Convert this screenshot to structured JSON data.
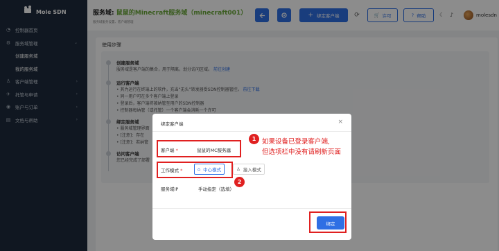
{
  "sidebar": {
    "logo": "Mole SDN",
    "items": [
      {
        "icon": "dashboard-icon",
        "label": "控制器首页",
        "chevron": false
      },
      {
        "icon": "gear-icon",
        "label": "服务域管理",
        "chevron": true
      },
      {
        "sub": true,
        "label": "创建服务域"
      },
      {
        "sub": true,
        "label": "我的服务域"
      },
      {
        "icon": "user-icon",
        "label": "客户端管理",
        "chevron": true
      },
      {
        "icon": "plane-icon",
        "label": "托管与申请",
        "chevron": true
      },
      {
        "icon": "account-icon",
        "label": "账户与订单",
        "chevron": true
      },
      {
        "icon": "doc-icon",
        "label": "文档与帮助",
        "chevron": true
      }
    ]
  },
  "header": {
    "title_prefix": "服务域:",
    "title_highlight": "鼠鼠的Minecraft服务域",
    "title_suffix": "（minecraft001）",
    "subtitle": "服务域服务设置、客户端管理",
    "bind_client_label": "绑定客户端",
    "license_label": "许可",
    "help_label": "帮助",
    "username": "molesdn"
  },
  "steps": {
    "card_title": "使用步骤",
    "items": [
      {
        "heading": "创建服务域",
        "lines": [
          {
            "text": "服务域是客户端的集合，用于隔离，划分访问区域。",
            "link": "前往创建"
          }
        ]
      },
      {
        "heading": "运行客户端",
        "lines": [
          {
            "text": "其为运行在终端上的软件，充当“无头”转发器受SDN控制器管控。",
            "link": "前往下载"
          },
          {
            "text": "同一用户可在多个客户端上登录"
          },
          {
            "text": "登录后，客户端将被纳管至用户的SDN控制器"
          },
          {
            "text": "控制器每纳管（或托管）一个客户端会消耗一个许可"
          }
        ]
      },
      {
        "heading": "绑定服务域",
        "lines": [
          {
            "text": "服务域管理界面"
          },
          {
            "text": "[注意]：存在"
          },
          {
            "text": "[注意]：若纳管"
          }
        ]
      },
      {
        "heading": "访问客户端",
        "lines": [
          {
            "text": "您已经完成了部署"
          }
        ]
      }
    ]
  },
  "modal": {
    "title": "绑定客户端",
    "close": "×",
    "client_label": "客户端",
    "client_value": "鼠鼠的MC服务器",
    "mode_label": "工作模式",
    "mode_options": [
      "中心模式",
      "接入模式"
    ],
    "mode_selected": "中心模式",
    "domain_ip_label": "服务域IP",
    "domain_ip_value": "手动指定（选填）",
    "required_mark": "*",
    "confirm_label": "绑定"
  },
  "annotations": {
    "badge1": "1",
    "badge2": "2",
    "note_line1": "如果设备已登录客户端,",
    "note_line2": "但选项栏中没有请刷新页面"
  },
  "colors": {
    "primary": "#2f6fe4",
    "sidebar": "#1e2b3c",
    "annotation": "#e02020",
    "highlight": "#6aa83a"
  }
}
